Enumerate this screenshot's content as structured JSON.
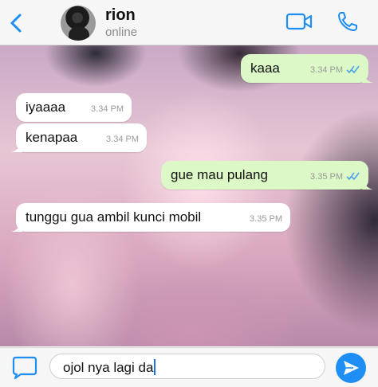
{
  "header": {
    "contact_name": "rion",
    "status": "online",
    "icons": {
      "back": "chevron-left-icon",
      "video": "video-camera-icon",
      "call": "phone-icon"
    }
  },
  "messages": [
    {
      "direction": "out",
      "text": "kaaa",
      "time": "3.34 PM",
      "read": true
    },
    {
      "direction": "in",
      "text": "iyaaaa",
      "time": "3.34 PM"
    },
    {
      "direction": "in",
      "text": "kenapaa",
      "time": "3.34 PM"
    },
    {
      "direction": "out",
      "text": "gue mau pulang",
      "time": "3.35 PM",
      "read": true
    },
    {
      "direction": "in",
      "text": "tunggu gua ambil kunci mobil",
      "time": "3.35 PM"
    }
  ],
  "composer": {
    "value": "ojol nya lagi da",
    "icons": {
      "sticker": "sticker-icon",
      "send": "send-icon"
    }
  },
  "colors": {
    "accent": "#1e8ef5",
    "outgoing_bubble": "#dcf8c6",
    "incoming_bubble": "#ffffff",
    "read_ticks": "#4fa3e6"
  }
}
